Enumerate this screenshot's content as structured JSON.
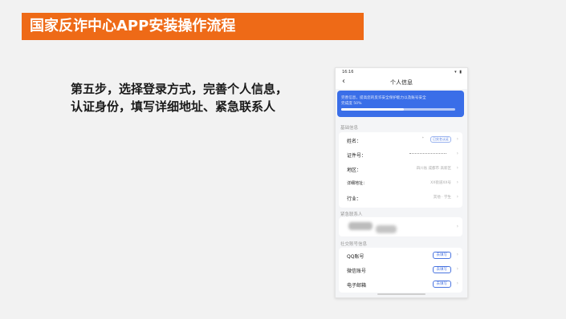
{
  "slide": {
    "title": "国家反诈中心APP安装操作流程",
    "step_text": "第五步，选择登录方式，完善个人信息，认证身份，填写详细地址、紧急联系人"
  },
  "phone": {
    "status_time": "16:16",
    "nav_title": "个人信息",
    "banner": {
      "line1": "完善信息，提高您的反诈安全保护能力以及账号安全",
      "line2": "完成度 50%",
      "progress_fraction": 0.55
    },
    "basic_section_label": "基础信息",
    "basic_rows": [
      {
        "label": "姓名：",
        "value": "*",
        "badge": "已实名认证"
      },
      {
        "label": "证件号：",
        "value": ""
      },
      {
        "label": "地区：",
        "value": "四川省 成都市 高新区"
      },
      {
        "label": "详细地址：",
        "value": "XX街道XX号"
      },
      {
        "label": "行业：",
        "value": "其他 · 学生"
      }
    ],
    "emergency_section_label": "紧急联系人",
    "social_section_label": "社交账号信息",
    "social_rows": [
      {
        "label": "QQ账号",
        "action": "去填写"
      },
      {
        "label": "微信账号",
        "action": "去填写"
      },
      {
        "label": "电子邮箱",
        "action": "去填写"
      }
    ]
  }
}
